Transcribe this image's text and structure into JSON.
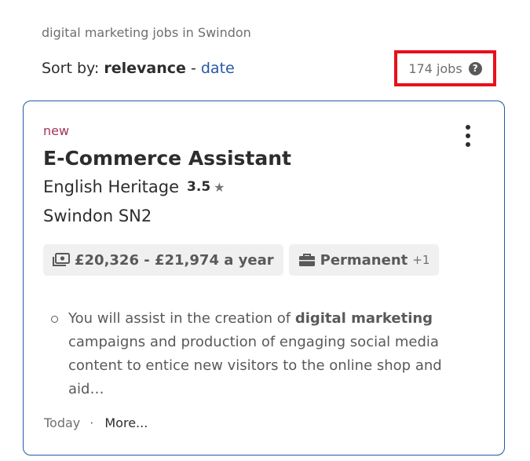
{
  "search": {
    "caption": "digital marketing jobs in Swindon"
  },
  "sort": {
    "prefix": "Sort by:",
    "current": "relevance",
    "separator": "-",
    "alternative": "date"
  },
  "results": {
    "count": "174 jobs",
    "help_glyph": "?"
  },
  "job": {
    "badge": "new",
    "title": "E-Commerce Assistant",
    "company": "English Heritage",
    "rating": "3.5",
    "rating_star": "★",
    "location": "Swindon SN2",
    "salary": "£20,326 - £21,974 a year",
    "job_type": "Permanent",
    "job_type_extra": "+1",
    "snippet": {
      "before": "You will assist in the creation of ",
      "highlight": "digital marketing",
      "after": " campaigns and production of engaging social media content to entice new visitors to the online shop and aid…"
    },
    "posted": "Today",
    "footer_dot": "·",
    "more": "More..."
  },
  "colors": {
    "link_blue": "#2557a7",
    "new_badge": "#a2365c",
    "highlight_box": "#e8101b"
  },
  "icons": [
    "help-icon",
    "kebab-menu-icon",
    "star-icon",
    "salary-icon",
    "briefcase-icon"
  ]
}
